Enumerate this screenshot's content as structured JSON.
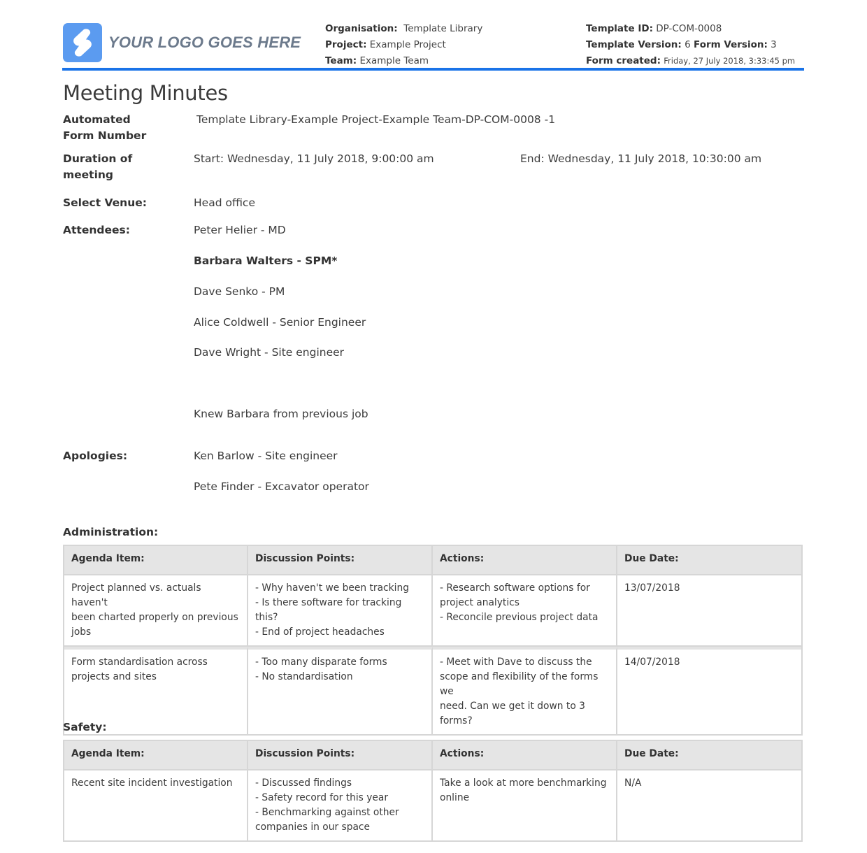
{
  "header": {
    "logo_text": "YOUR LOGO GOES HERE",
    "organisation_label": "Organisation:",
    "organisation_value": "Template Library",
    "project_label": "Project:",
    "project_value": "Example Project",
    "team_label": "Team:",
    "team_value": "Example Team",
    "template_id_label": "Template ID:",
    "template_id_value": "DP-COM-0008",
    "template_version_label": "Template Version:",
    "template_version_value": "6",
    "form_version_label": "Form Version:",
    "form_version_value": "3",
    "form_created_label": "Form created:",
    "form_created_value": "Friday, 27 July 2018, 3:33:45 pm",
    "accent_color": "#1a73e8"
  },
  "title": "Meeting Minutes",
  "fields": {
    "form_number": {
      "label_line1": "Automated",
      "label_line2": "Form Number",
      "value": "Template Library-Example Project-Example Team-DP-COM-0008   -1"
    },
    "duration": {
      "label_line1": "Duration of",
      "label_line2": "meeting",
      "start": "Start: Wednesday, 11 July 2018, 9:00:00 am",
      "end": "End: Wednesday, 11 July 2018, 10:30:00 am"
    },
    "venue": {
      "label": "Select Venue:",
      "value": "Head office"
    },
    "attendees": {
      "label": "Attendees:",
      "items": [
        {
          "text": "Peter Helier - MD",
          "bold": false
        },
        {
          "text": "Barbara Walters - SPM*",
          "bold": true
        },
        {
          "text": "Dave Senko - PM",
          "bold": false
        },
        {
          "text": "Alice Coldwell - Senior Engineer",
          "bold": false
        },
        {
          "text": "Dave Wright - Site engineer",
          "bold": false
        }
      ],
      "note": "Knew Barbara from previous job"
    },
    "apologies": {
      "label": "Apologies:",
      "items": [
        "Ken Barlow - Site engineer",
        "Pete Finder - Excavator operator"
      ]
    }
  },
  "sections": [
    {
      "title": "Administration:",
      "columns": [
        "Agenda Item:",
        "Discussion Points:",
        "Actions:",
        "Due Date:"
      ],
      "rows": [
        {
          "agenda": [
            "Project planned vs. actuals haven't",
            "been charted properly on previous",
            "jobs"
          ],
          "discussion": [
            "- Why haven't we been tracking",
            "- Is there software for tracking this?",
            "- End of project headaches"
          ],
          "actions": [
            "- Research software options for",
            "project analytics",
            "- Reconcile previous project data"
          ],
          "due": "13/07/2018"
        },
        {
          "agenda": [
            "Form standardisation across",
            "projects and sites"
          ],
          "discussion": [
            "- Too many disparate forms",
            "- No standardisation"
          ],
          "actions": [
            "- Meet with Dave to discuss the",
            "scope and flexibility of the forms we",
            "need. Can we get it down to 3",
            "forms?"
          ],
          "due": "14/07/2018"
        }
      ]
    },
    {
      "title": "Safety:",
      "columns": [
        "Agenda Item:",
        "Discussion Points:",
        "Actions:",
        "Due Date:"
      ],
      "rows": [
        {
          "agenda": [
            "Recent site incident investigation"
          ],
          "discussion": [
            "- Discussed findings",
            "- Safety record for this year",
            "- Benchmarking against other",
            "companies in our space"
          ],
          "actions": [
            "Take a look at more benchmarking",
            "online"
          ],
          "due": "N/A"
        }
      ]
    }
  ]
}
